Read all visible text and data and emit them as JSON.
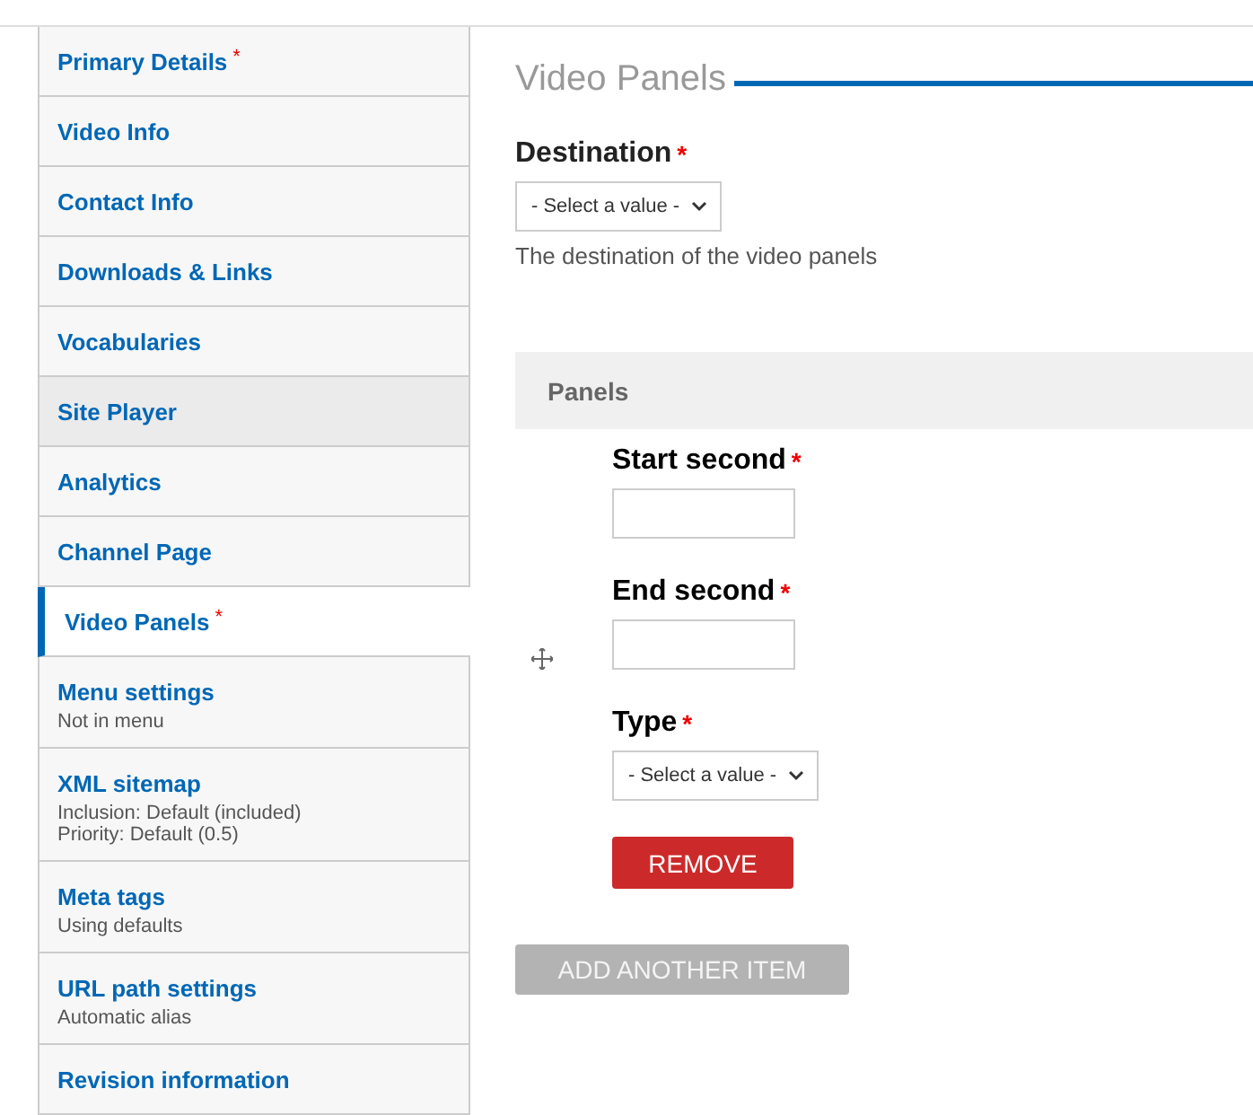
{
  "sidebar": {
    "items": [
      {
        "label": "Primary Details",
        "required_mark": "*",
        "selected": false,
        "highlighted": false
      },
      {
        "label": "Video Info",
        "selected": false,
        "highlighted": false
      },
      {
        "label": "Contact Info",
        "selected": false,
        "highlighted": false
      },
      {
        "label": "Downloads & Links",
        "selected": false,
        "highlighted": false
      },
      {
        "label": "Vocabularies",
        "selected": false,
        "highlighted": false
      },
      {
        "label": "Site Player",
        "selected": false,
        "highlighted": true
      },
      {
        "label": "Analytics",
        "selected": false,
        "highlighted": false
      },
      {
        "label": "Channel Page",
        "selected": false,
        "highlighted": false
      },
      {
        "label": "Video Panels",
        "required_mark": "*",
        "selected": true,
        "highlighted": false
      },
      {
        "label": "Menu settings",
        "selected": false,
        "highlighted": false,
        "summary": [
          "Not in menu"
        ]
      },
      {
        "label": "XML sitemap",
        "selected": false,
        "highlighted": false,
        "summary": [
          "Inclusion: Default (included)",
          "Priority: Default (0.5)"
        ]
      },
      {
        "label": "Meta tags",
        "selected": false,
        "highlighted": false,
        "summary": [
          "Using defaults"
        ]
      },
      {
        "label": "URL path settings",
        "selected": false,
        "highlighted": false,
        "summary": [
          "Automatic alias"
        ]
      },
      {
        "label": "Revision information",
        "selected": false,
        "highlighted": false
      }
    ]
  },
  "main": {
    "title": "Video Panels",
    "destination": {
      "label": "Destination",
      "required_mark": "*",
      "value": "- Select a value -",
      "description": "The destination of the video panels"
    },
    "panels": {
      "title": "Panels",
      "fields": [
        {
          "kind": "text",
          "label": "Start second",
          "required_mark": "*"
        },
        {
          "kind": "text",
          "label": "End second",
          "required_mark": "*"
        },
        {
          "kind": "select",
          "label": "Type",
          "required_mark": "*",
          "value": "- Select a value -"
        }
      ],
      "remove_button": "REMOVE",
      "add_button": {
        "label": "ADD ANOTHER ITEM",
        "disabled": true
      }
    }
  }
}
